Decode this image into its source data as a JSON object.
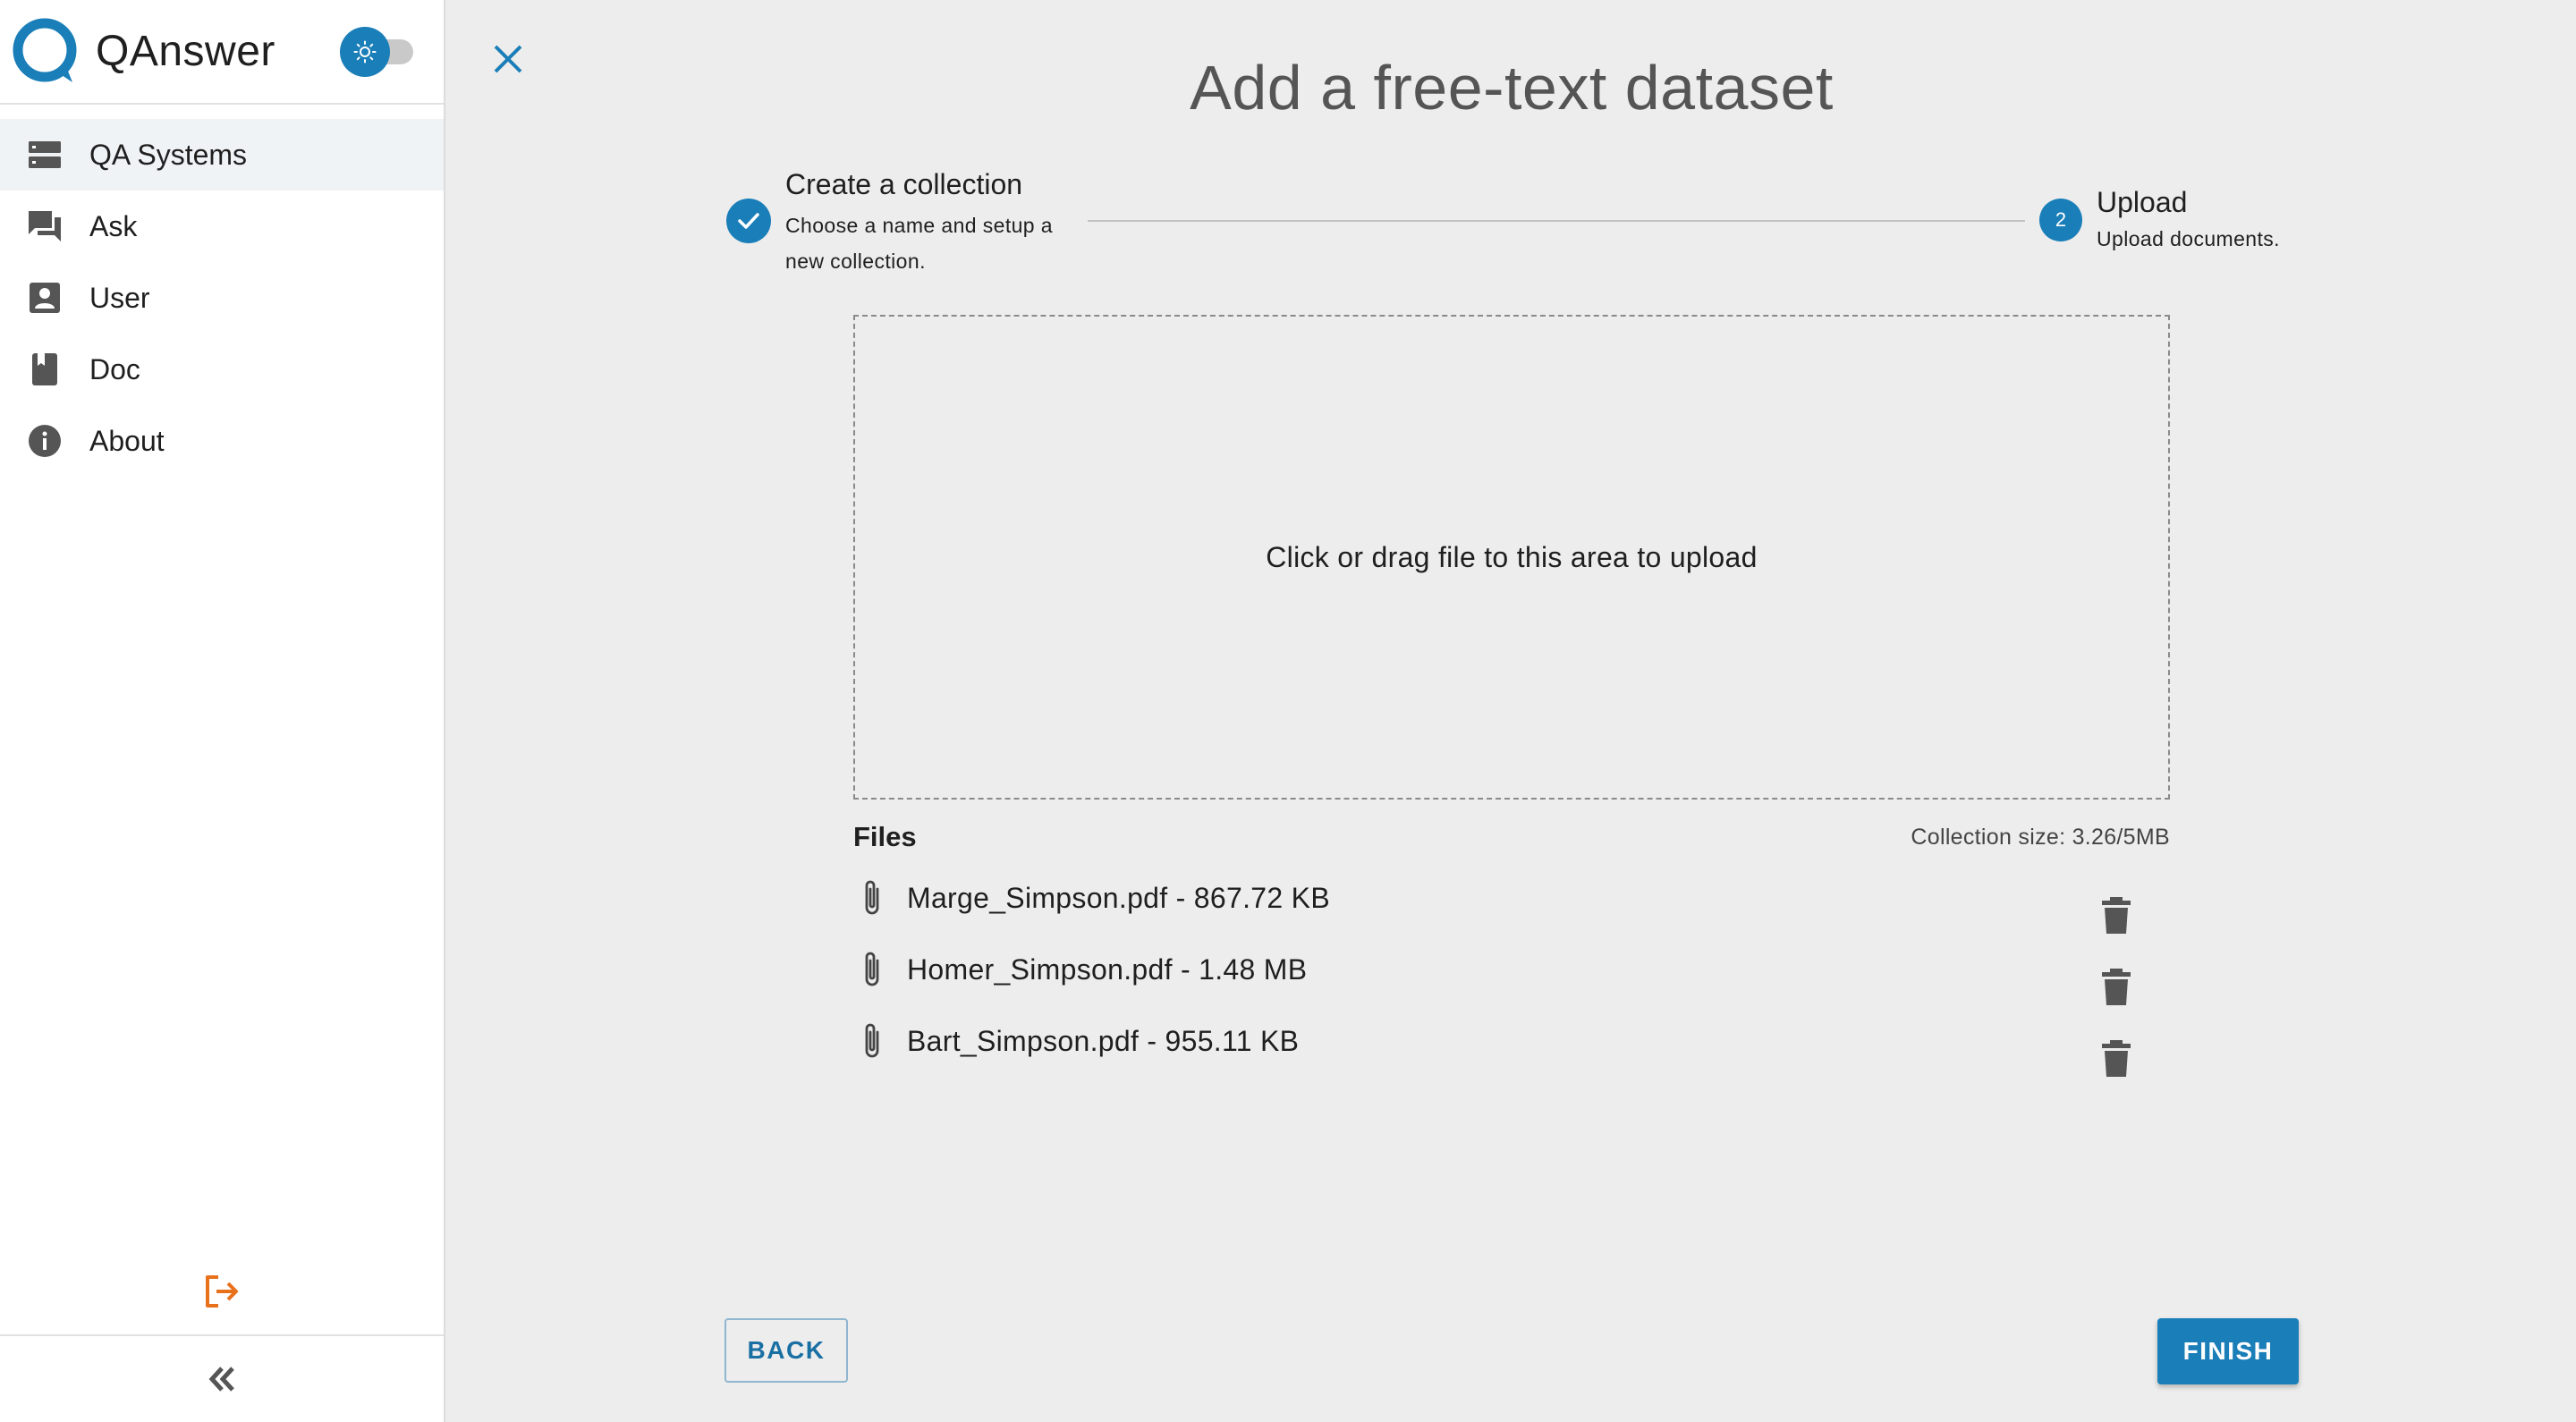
{
  "app": {
    "name": "QAnswer",
    "brand_color": "#1a7eb8",
    "logout_color": "#e8711c"
  },
  "sidebar": {
    "theme_toggle": {
      "state": "light",
      "icon": "sun-icon"
    },
    "items": [
      {
        "label": "QA Systems",
        "icon": "server-icon",
        "active": true
      },
      {
        "label": "Ask",
        "icon": "chat-icon",
        "active": false
      },
      {
        "label": "User",
        "icon": "user-icon",
        "active": false
      },
      {
        "label": "Doc",
        "icon": "book-icon",
        "active": false
      },
      {
        "label": "About",
        "icon": "info-icon",
        "active": false
      }
    ],
    "logout_icon": "logout-icon",
    "collapse_icon": "double-chevron-left-icon"
  },
  "main": {
    "close_icon": "close-icon",
    "title": "Add a free-text dataset",
    "stepper": {
      "steps": [
        {
          "title": "Create a collection",
          "description": "Choose a name and setup a new collection.",
          "status": "done"
        },
        {
          "number": "2",
          "title": "Upload",
          "description": "Upload documents.",
          "status": "active"
        }
      ]
    },
    "dropzone": {
      "text": "Click or drag file to this area to upload"
    },
    "files": {
      "heading": "Files",
      "collection_size": "Collection size: 3.26/5MB",
      "items": [
        {
          "label": "Marge_Simpson.pdf - 867.72 KB"
        },
        {
          "label": "Homer_Simpson.pdf - 1.48 MB"
        },
        {
          "label": "Bart_Simpson.pdf - 955.11 KB"
        }
      ]
    },
    "buttons": {
      "back": "BACK",
      "finish": "FINISH"
    }
  }
}
